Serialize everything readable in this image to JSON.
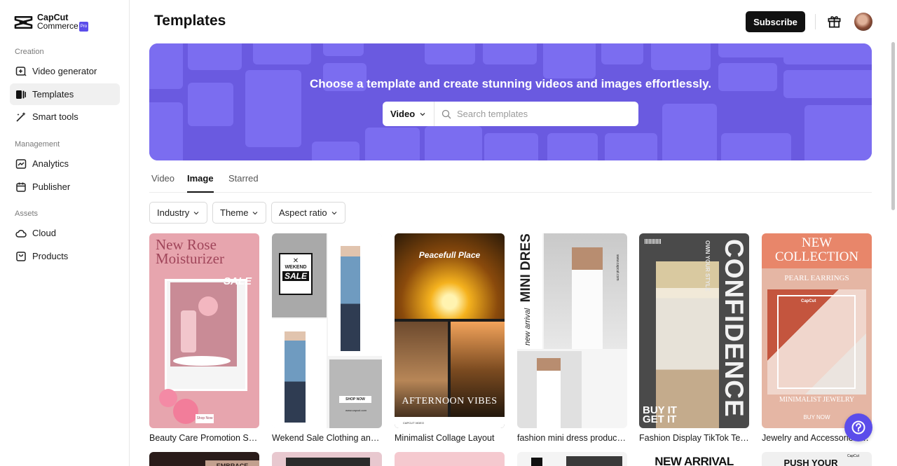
{
  "brand": {
    "name": "CapCut",
    "sub": "Commerce",
    "badge": "Pro"
  },
  "sidebar": {
    "sections": [
      {
        "label": "Creation",
        "items": [
          {
            "label": "Video generator",
            "icon": "video-add-icon"
          },
          {
            "label": "Templates",
            "icon": "templates-icon",
            "active": true
          },
          {
            "label": "Smart tools",
            "icon": "magic-wand-icon"
          }
        ]
      },
      {
        "label": "Management",
        "items": [
          {
            "label": "Analytics",
            "icon": "chart-icon"
          },
          {
            "label": "Publisher",
            "icon": "calendar-icon"
          }
        ]
      },
      {
        "label": "Assets",
        "items": [
          {
            "label": "Cloud",
            "icon": "cloud-icon"
          },
          {
            "label": "Products",
            "icon": "bag-icon"
          }
        ]
      }
    ]
  },
  "header": {
    "title": "Templates",
    "subscribe_label": "Subscribe"
  },
  "banner": {
    "headline": "Choose a template and create stunning videos and images effortlessly.",
    "search_type": "Video",
    "search_placeholder": "Search templates",
    "color": "#6a5ae0"
  },
  "tabs": [
    "Video",
    "Image",
    "Starred"
  ],
  "active_tab": "Image",
  "filters": [
    "Industry",
    "Theme",
    "Aspect ratio"
  ],
  "templates": [
    {
      "title": "Beauty Care Promotion Sale",
      "thumb_text": [
        "New Rose",
        "Moisturizer",
        "SALE",
        "Shop Now"
      ]
    },
    {
      "title": "Wekend Sale Clothing and Apparel",
      "thumb_text": [
        "WEKEND",
        "SALE",
        "SHOP NOW",
        "www.capcut.com"
      ]
    },
    {
      "title": "Minimalist Collage Layout",
      "thumb_text": [
        "Peacefull Place",
        "AFTERNOON VIBES",
        "CAPCUT VIDEO"
      ]
    },
    {
      "title": "fashion mini dress product display",
      "thumb_text": [
        "new arrival",
        "MINI DRESS",
        "www.capcut.com"
      ]
    },
    {
      "title": "Fashion Display TikTok Template",
      "thumb_text": [
        "OWN YOUR STYLE",
        "CONFIDENCE",
        "BUY IT",
        "GET IT"
      ]
    },
    {
      "title": "Jewelry and Accessories Promo",
      "thumb_text": [
        "NEW",
        "COLLECTION",
        "PEARL EARRINGS",
        "MINIMALIST JEWELRY",
        "BUY NOW",
        "CapCut"
      ]
    }
  ],
  "second_row_text": [
    "EMBRACE",
    "NEW ARRIVAL",
    "PUSH YOUR",
    "CapCut"
  ],
  "colors": {
    "accent": "#5b4dea",
    "dark": "#111111"
  }
}
